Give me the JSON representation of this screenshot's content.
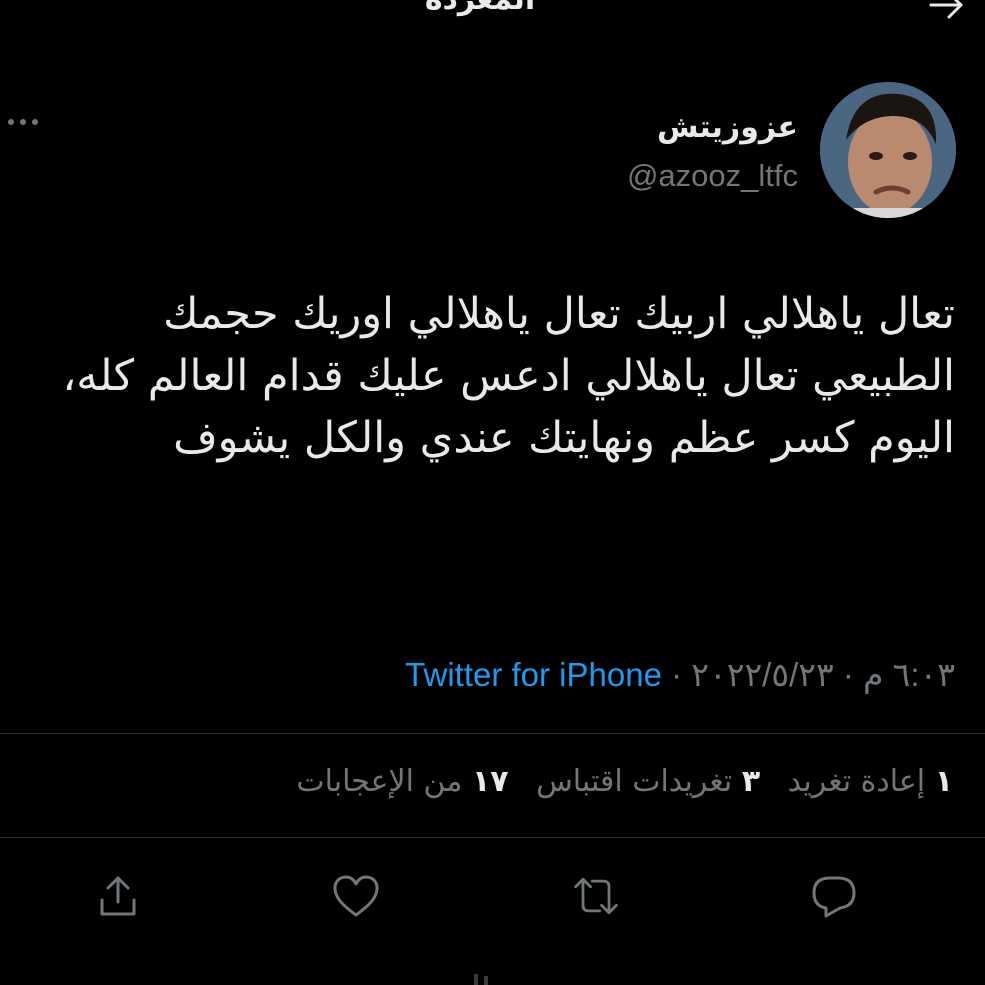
{
  "header": {
    "title": "المغردة"
  },
  "tweet": {
    "display_name": "عزوزيتش",
    "handle": "@azooz_ltfc",
    "text": "تعال ياهلالي اربيك تعال ياهلالي اوريك حجمك الطبيعي تعال ياهلالي ادعس عليك قدام العالم كله، اليوم كسر عظم ونهايتك عندي والكل يشوف",
    "time": "٦:٠٣ م",
    "date": "٢٠٢٢/٥/٢٣",
    "separator": "·",
    "source": "Twitter for iPhone"
  },
  "stats": {
    "retweets_count": "١",
    "retweets_label": "إعادة تغريد",
    "quotes_count": "٣",
    "quotes_label": "تغريدات اقتباس",
    "likes_count": "١٧",
    "likes_label": "من الإعجابات"
  },
  "colors": {
    "background": "#000000",
    "text": "#e7e9ea",
    "secondary": "#71767b",
    "accent": "#1d9bf0",
    "divider": "#2f3336"
  },
  "icons": {
    "reply": "reply-icon",
    "retweet": "retweet-icon",
    "like": "heart-icon",
    "share": "share-icon",
    "back": "arrow-icon",
    "more": "more-icon"
  }
}
